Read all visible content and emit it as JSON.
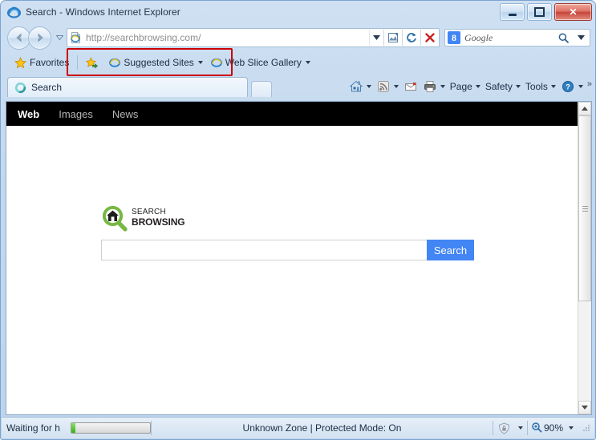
{
  "window": {
    "title": "Search - Windows Internet Explorer",
    "minimize_label": "Minimize",
    "maximize_label": "Maximize",
    "close_label": "Close"
  },
  "toolbar": {
    "back_label": "Back",
    "forward_label": "Forward",
    "recent_pages_label": "Recent Pages",
    "address": {
      "url": "http://searchbrowsing.com/",
      "dropdown_label": "Address dropdown",
      "compatibility_label": "Compatibility View",
      "refresh_label": "Refresh",
      "stop_label": "Stop"
    },
    "search": {
      "provider": "Google",
      "provider_badge": "8",
      "go_label": "Search",
      "options_label": "Search options"
    }
  },
  "favorites_bar": {
    "favorites_label": "Favorites",
    "items": [
      {
        "label": "Suggested Sites",
        "icon": "ie-icon",
        "has_caret": true
      },
      {
        "label": "Web Slice Gallery",
        "icon": "ie-icon",
        "has_caret": true
      }
    ]
  },
  "tabs": {
    "items": [
      {
        "label": "Search",
        "icon": "loading-spinner-icon",
        "active": true
      }
    ],
    "new_tab_label": "New Tab"
  },
  "command_bar": {
    "items": [
      {
        "name": "home",
        "label": "",
        "icon": "home-icon",
        "has_caret": true
      },
      {
        "name": "feeds",
        "label": "",
        "icon": "rss-icon",
        "has_caret": true
      },
      {
        "name": "mail",
        "label": "",
        "icon": "mail-icon",
        "has_caret": false
      },
      {
        "name": "print",
        "label": "",
        "icon": "printer-icon",
        "has_caret": true
      },
      {
        "name": "page",
        "label": "Page",
        "icon": "",
        "has_caret": true
      },
      {
        "name": "safety",
        "label": "Safety",
        "icon": "",
        "has_caret": true
      },
      {
        "name": "tools",
        "label": "Tools",
        "icon": "",
        "has_caret": true
      },
      {
        "name": "help",
        "label": "",
        "icon": "help-icon",
        "has_caret": true
      }
    ],
    "overflow_label": "»"
  },
  "page": {
    "nav": [
      {
        "label": "Web",
        "active": true
      },
      {
        "label": "Images",
        "active": false
      },
      {
        "label": "News",
        "active": false
      }
    ],
    "logo": {
      "line1": "SEARCH",
      "line2": "BROWSING",
      "mark": "magnifier-house-icon",
      "color": "#76b843"
    },
    "search": {
      "query_value": "",
      "query_placeholder": "",
      "button_label": "Search",
      "button_color": "#4285f4"
    }
  },
  "scrollbar": {
    "up_label": "Scroll up",
    "down_label": "Scroll down",
    "thumb_label": "Scroll thumb"
  },
  "status_bar": {
    "status_text": "Waiting for h",
    "progress_percent": 5,
    "zone_text": "Unknown Zone | Protected Mode: On",
    "zone_icon": "security-zone-icon",
    "zoom_level": "90%",
    "zoom_icon": "zoom-in-icon"
  },
  "annotation": {
    "highlight_color": "#cc0000",
    "target": "address-bar"
  }
}
